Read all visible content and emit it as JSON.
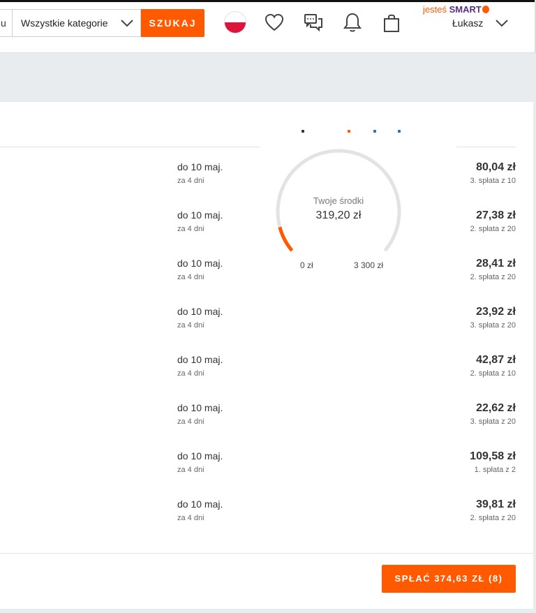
{
  "header": {
    "search_fragment": "u",
    "category_select": "Wszystkie kategorie",
    "search_button": "SZUKAJ",
    "smart_prefix": "jesteś",
    "smart_brand": "SMART",
    "user_name": "Łukasz"
  },
  "colors": {
    "accent": "#ff5a00",
    "smart_brand": "#5a2d82",
    "gauge_track": "#e3e3e3"
  },
  "gauge": {
    "label": "Twoje środki",
    "value": "319,20 zł",
    "min_label": "0 zł",
    "max_label": "3 300 zł",
    "used_fraction": 0.0967
  },
  "payments": [
    {
      "due": "do 10 maj.",
      "days": "za 4 dni",
      "amount": "80,04 zł",
      "installment": "3. spłata z 10"
    },
    {
      "due": "do 10 maj.",
      "days": "za 4 dni",
      "amount": "27,38 zł",
      "installment": "2. spłata z 20"
    },
    {
      "due": "do 10 maj.",
      "days": "za 4 dni",
      "amount": "28,41 zł",
      "installment": "2. spłata z 20"
    },
    {
      "due": "do 10 maj.",
      "days": "za 4 dni",
      "amount": "23,92 zł",
      "installment": "3. spłata z 20"
    },
    {
      "due": "do 10 maj.",
      "days": "za 4 dni",
      "amount": "42,87 zł",
      "installment": "2. spłata z 10"
    },
    {
      "due": "do 10 maj.",
      "days": "za 4 dni",
      "amount": "22,62 zł",
      "installment": "3. spłata z 20"
    },
    {
      "due": "do 10 maj.",
      "days": "za 4 dni",
      "amount": "109,58 zł",
      "installment": "1. spłata z 2"
    },
    {
      "due": "do 10 maj.",
      "days": "za 4 dni",
      "amount": "39,81 zł",
      "installment": "2. spłata z 20"
    }
  ],
  "footer": {
    "pay_button": "SPŁAĆ 374,63 ZŁ (8)"
  }
}
